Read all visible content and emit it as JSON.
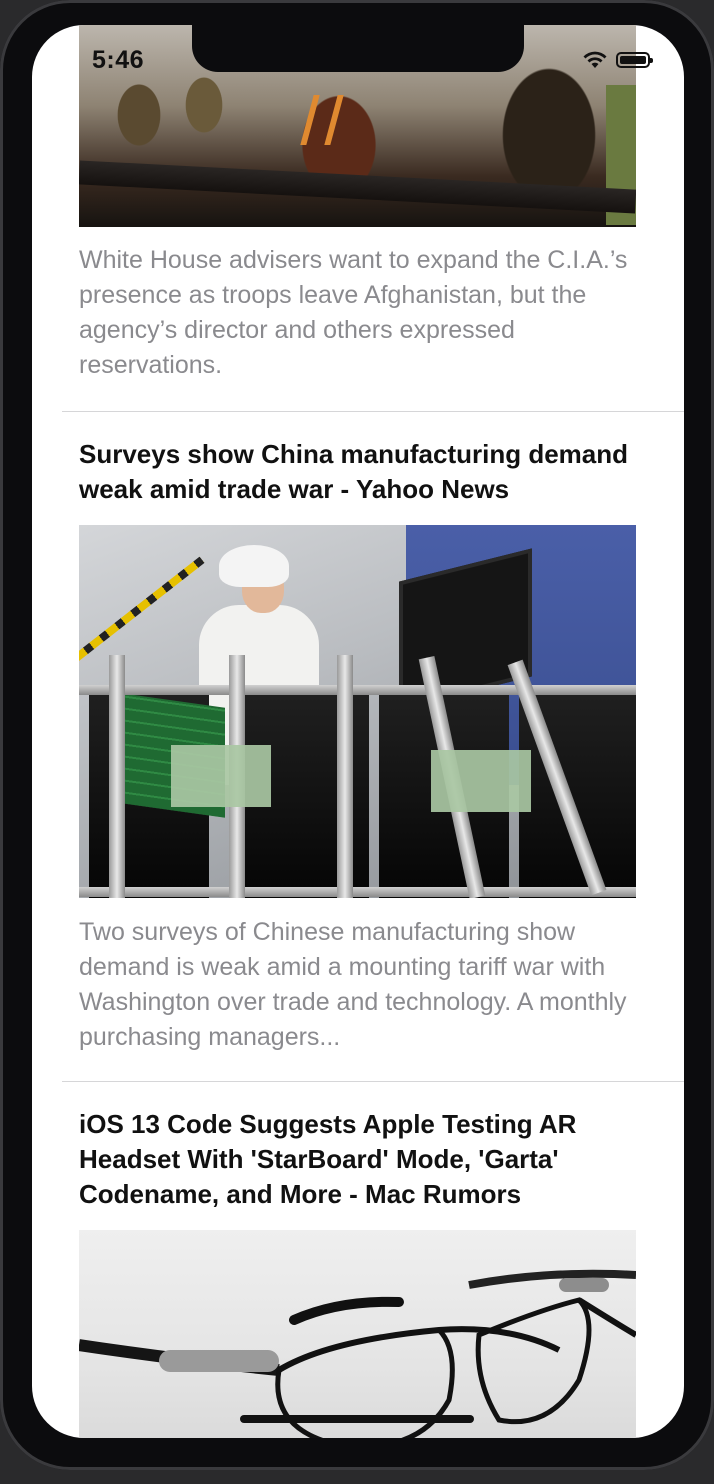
{
  "status_bar": {
    "time": "5:46"
  },
  "articles": [
    {
      "headline": "",
      "summary": "White House advisers want to expand the C.I.A.’s presence as troops leave Afghanistan, but the agency’s director and others expressed reservations.",
      "image": "military-troops-photo"
    },
    {
      "headline": "Surveys show China manufacturing demand weak amid trade war - Yahoo News",
      "summary": "Two surveys of Chinese manufacturing show demand is weak amid a mounting tariff war with Washington over trade and technology. A monthly purchasing managers...",
      "image": "factory-worker-photo"
    },
    {
      "headline": "iOS 13 Code Suggests Apple Testing AR Headset With 'StarBoard' Mode, 'Garta' Codename, and More - Mac Rumors",
      "summary": "",
      "image": "ar-glasses-photo"
    }
  ],
  "icons": [
    "wifi-icon",
    "battery-icon"
  ]
}
